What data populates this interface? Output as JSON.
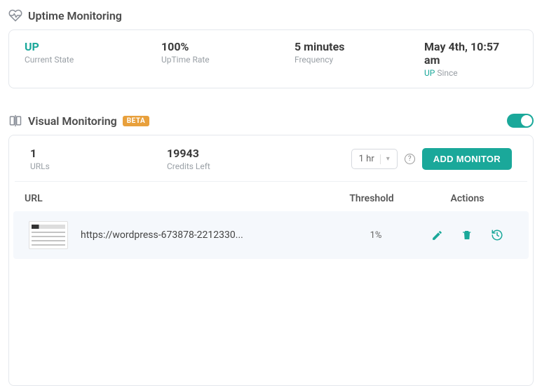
{
  "uptime": {
    "section_title": "Uptime Monitoring",
    "stats": {
      "state_value": "UP",
      "state_label": "Current State",
      "rate_value": "100%",
      "rate_label": "UpTime Rate",
      "freq_value": "5 minutes",
      "freq_label": "Frequency",
      "since_value": "May 4th, 10:57 am",
      "since_label_up": "UP",
      "since_label_rest": " Since"
    }
  },
  "visual": {
    "section_title": "Visual Monitoring",
    "beta_label": "BETA",
    "urls_count": "1",
    "urls_label": "URLs",
    "credits_value": "19943",
    "credits_label": "Credits Left",
    "interval_value": "1 hr",
    "add_button": "ADD MONITOR",
    "columns": {
      "url": "URL",
      "threshold": "Threshold",
      "actions": "Actions"
    },
    "rows": [
      {
        "url": "https://wordpress-673878-2212330...",
        "threshold": "1%"
      }
    ]
  }
}
